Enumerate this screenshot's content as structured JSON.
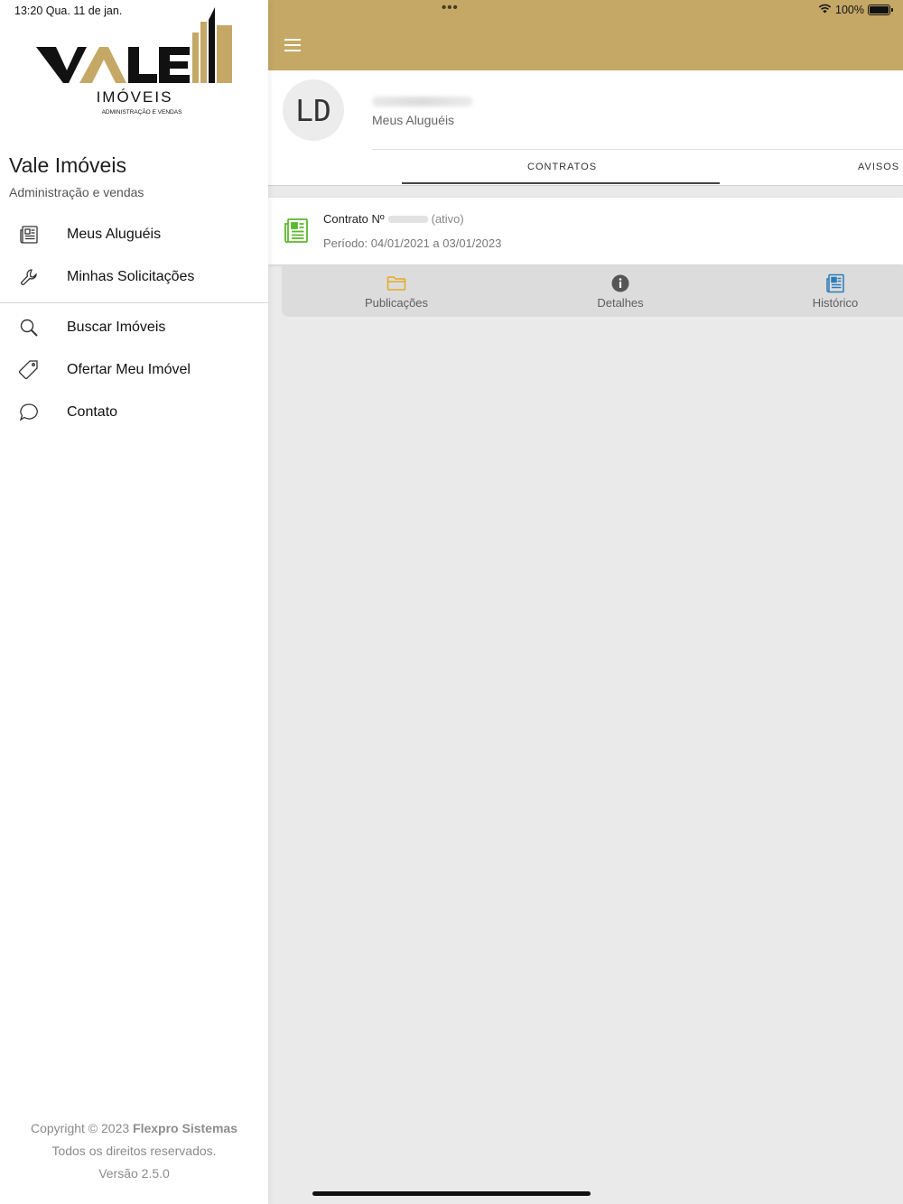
{
  "status_bar": {
    "time_date": "13:20   Qua. 11 de jan.",
    "dots": "•••",
    "battery": "100%",
    "battery_level": 1.0
  },
  "sidebar": {
    "logo": {
      "word": "VALE",
      "sub": "IMÓVEIS",
      "tagline": "ADMINISTRAÇÃO E VENDAS"
    },
    "title": "Vale Imóveis",
    "subtitle": "Administração e vendas",
    "items": [
      {
        "label": "Meus Aluguéis",
        "icon": "newspaper-icon"
      },
      {
        "label": "Minhas Solicitações",
        "icon": "wrench-icon"
      },
      {
        "label": "Buscar Imóveis",
        "icon": "search-icon"
      },
      {
        "label": "Ofertar Meu Imóvel",
        "icon": "tag-icon"
      },
      {
        "label": "Contato",
        "icon": "chat-icon"
      }
    ],
    "footer": {
      "copyright_prefix": "Copyright © 2023",
      "company": "Flexpro Sistemas",
      "rights": "Todos os direitos reservados.",
      "version": "Versão 2.5.0"
    }
  },
  "header": {
    "menu_icon": "hamburger-icon",
    "color": "#c5a866"
  },
  "profile": {
    "initials": "LD",
    "subtitle": "Meus Aluguéis"
  },
  "tabs": [
    {
      "label": "CONTRATOS",
      "active": true
    },
    {
      "label": "AVISOS",
      "active": false
    }
  ],
  "contract": {
    "title_prefix": "Contrato Nº",
    "status": "(ativo)",
    "period": "Período: 04/01/2021 a 03/01/2023",
    "icon": "document-icon"
  },
  "actions": [
    {
      "label": "Publicações",
      "icon": "folder-icon",
      "color": "#e5a823"
    },
    {
      "label": "Detalhes",
      "icon": "info-icon",
      "color": "#555555"
    },
    {
      "label": "Histórico",
      "icon": "newspaper-icon",
      "color": "#2a7bb8"
    }
  ]
}
